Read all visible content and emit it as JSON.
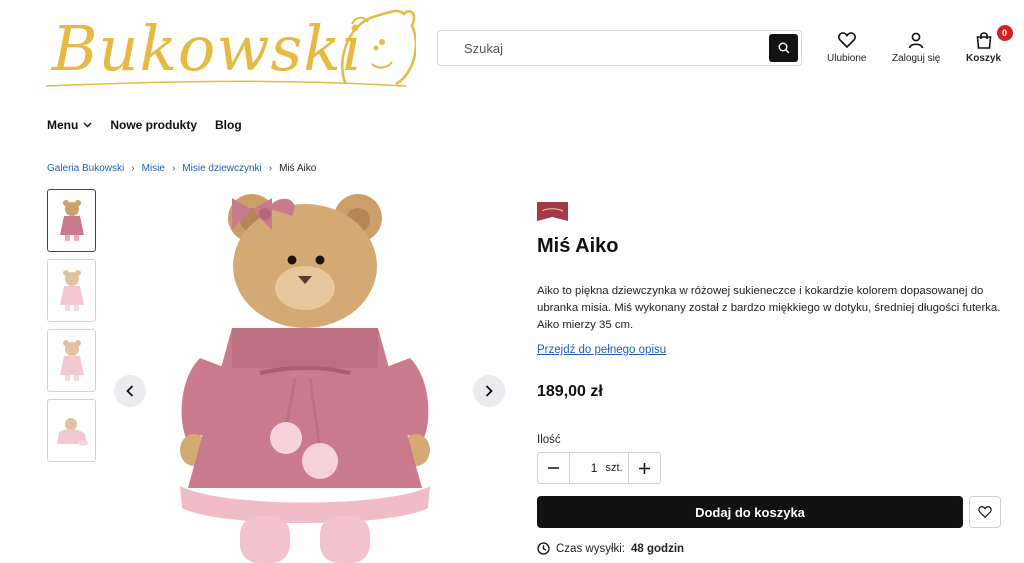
{
  "header": {
    "logo_text": "Bukowski",
    "search_placeholder": "Szukaj",
    "favorites_label": "Ulubione",
    "login_label": "Zaloguj się",
    "cart_label": "Koszyk",
    "cart_count": "0"
  },
  "nav": {
    "menu_label": "Menu",
    "new_products_label": "Nowe produkty",
    "blog_label": "Blog"
  },
  "breadcrumb": {
    "items": [
      "Galeria Bukowski",
      "Misie",
      "Misie dziewczynki"
    ],
    "current": "Miś Aiko"
  },
  "product": {
    "title": "Miś Aiko",
    "description": "Aiko to piękna dziewczynka w różowej sukieneczce i kokardzie kolorem dopasowanej do ubranka misia. Miś wykonany został z bardzo miękkiego w dotyku, średniej długości futerka. Aiko mierzy 35 cm.",
    "full_description_link": "Przejdź do pełnego opisu",
    "price": "189,00 zł",
    "quantity_label": "Ilość",
    "quantity_value": "1",
    "quantity_unit": "szt.",
    "add_to_cart_label": "Dodaj do koszyka",
    "shipping_label": "Czas wysyłki:",
    "shipping_value": "48 godzin"
  },
  "colors": {
    "accent_gold": "#e6b940",
    "dress_pink": "#c97a8c",
    "link_blue": "#1f5fae",
    "badge_red": "#d42020"
  }
}
